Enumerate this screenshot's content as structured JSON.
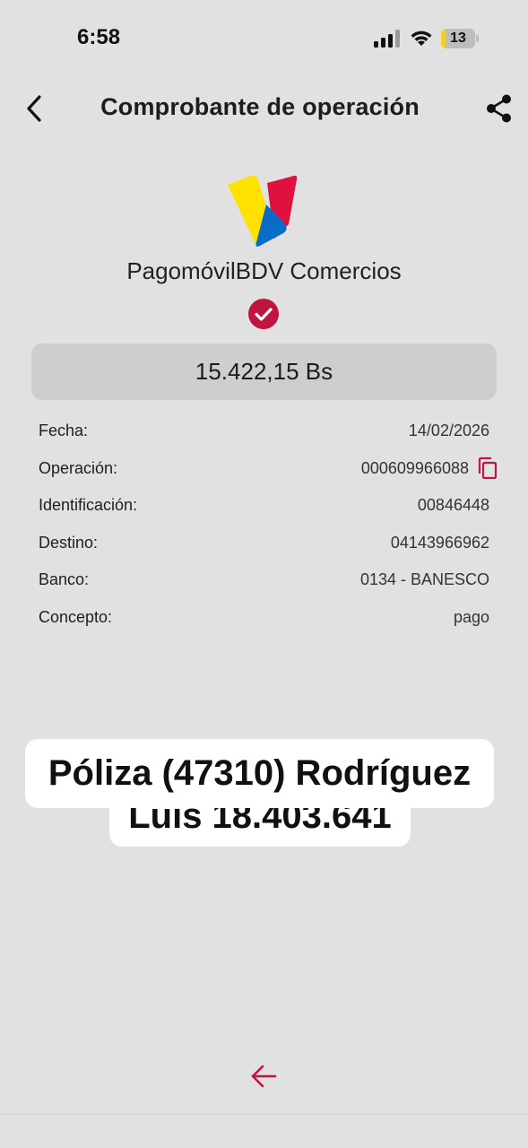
{
  "status_bar": {
    "time": "6:58",
    "battery_level": "13",
    "battery_fraction": 0.13,
    "icons": [
      "signal-icon",
      "wifi-icon",
      "battery-icon"
    ]
  },
  "header": {
    "title": "Comprobante de operación",
    "back_icon": "chevron-left-icon",
    "share_icon": "share-icon"
  },
  "brand": {
    "name": "PagomóvilBDV Comercios",
    "logo_colors": {
      "yellow": "#FFE100",
      "red": "#E0103F",
      "blue": "#0A6CC9"
    }
  },
  "status": {
    "icon": "check-circle-icon",
    "color": "#C1143E"
  },
  "amount": "15.422,15 Bs",
  "details": [
    {
      "label": "Fecha:",
      "value": "14/02/2026"
    },
    {
      "label": "Operación:",
      "value": "000609966088"
    },
    {
      "label": "Identificación:",
      "value": "00846448"
    },
    {
      "label": "Destino:",
      "value": "04143966962"
    },
    {
      "label": "Banco:",
      "value": "0134 - BANESCO"
    },
    {
      "label": "Concepto:",
      "value": "pago"
    }
  ],
  "overlay_caption": {
    "line1": "Póliza (47310) Rodríguez",
    "line2": "Luis 18.403.641"
  },
  "accent_color": "#C1143E"
}
